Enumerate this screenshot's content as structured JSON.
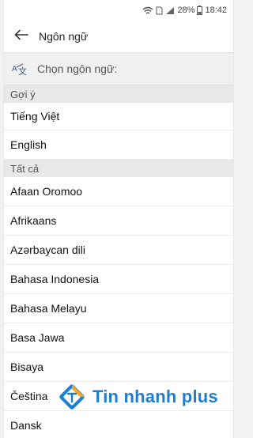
{
  "status_bar": {
    "battery_percent": "28%",
    "time": "18:42",
    "icons": [
      "wifi-icon",
      "sim-icon",
      "signal-icon",
      "battery-icon"
    ]
  },
  "app_bar": {
    "back_icon": "arrow-left-icon",
    "title": "Ngôn ngữ"
  },
  "search": {
    "icon": "translate-icon",
    "placeholder": "Chọn ngôn ngữ:"
  },
  "sections": {
    "suggested": {
      "header": "Gợi ý",
      "items": [
        "Tiếng Việt",
        "English"
      ]
    },
    "all": {
      "header": "Tất cả",
      "items": [
        "Afaan Oromoo",
        "Afrikaans",
        "Azərbaycan dili",
        "Bahasa Indonesia",
        "Bahasa Melayu",
        "Basa Jawa",
        "Bisaya",
        "Čeština",
        "Dansk"
      ]
    }
  },
  "watermark": {
    "text": "Tin nhanh plus",
    "colors": {
      "primary": "#1a7fd0",
      "accent": "#f5a623"
    }
  }
}
